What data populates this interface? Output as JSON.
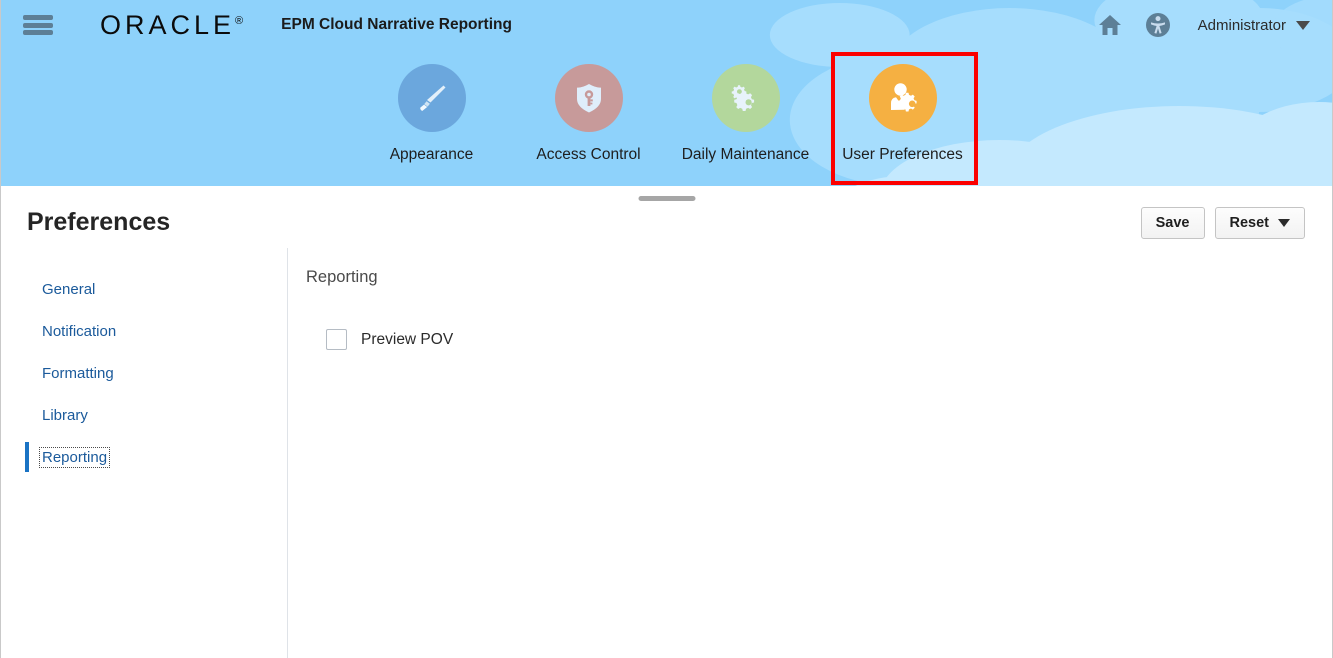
{
  "topbar": {
    "menu_icon": "hamburger-menu-icon",
    "logo_text": "ORACLE",
    "logo_mark": "®",
    "app_title": "EPM Cloud Narrative Reporting",
    "home_icon": "home-icon",
    "accessibility_icon": "accessibility-icon",
    "user_label": "Administrator",
    "user_caret": "chevron-down-icon"
  },
  "banner": {
    "sky_color": "#8ed2fb",
    "cloud_color_1": "#a6ddfd",
    "cloud_color_2": "#c4e9fe",
    "highlight_color": "#fb0000",
    "cards": [
      {
        "label": "Appearance",
        "icon": "paintbrush-icon",
        "circle_color": "#6ba7dd",
        "glyph_color": "#e3f0fa",
        "highlighted": false
      },
      {
        "label": "Access Control",
        "icon": "shield-key-icon",
        "circle_color": "#c79a9a",
        "glyph_color": "#dfeefb",
        "highlighted": false
      },
      {
        "label": "Daily Maintenance",
        "icon": "gears-icon",
        "circle_color": "#b3d79c",
        "glyph_color": "#e8f3fb",
        "highlighted": false
      },
      {
        "label": "User Preferences",
        "icon": "user-settings-icon",
        "circle_color": "#f5b042",
        "glyph_color": "#ffffff",
        "highlighted": true
      }
    ]
  },
  "page": {
    "title": "Preferences",
    "save_label": "Save",
    "reset_label": "Reset"
  },
  "sidebar": {
    "items": [
      {
        "label": "General",
        "selected": false
      },
      {
        "label": "Notification",
        "selected": false
      },
      {
        "label": "Formatting",
        "selected": false
      },
      {
        "label": "Library",
        "selected": false
      },
      {
        "label": "Reporting",
        "selected": true
      }
    ]
  },
  "panel": {
    "title": "Reporting",
    "options": [
      {
        "label": "Preview POV",
        "checked": false
      }
    ]
  }
}
